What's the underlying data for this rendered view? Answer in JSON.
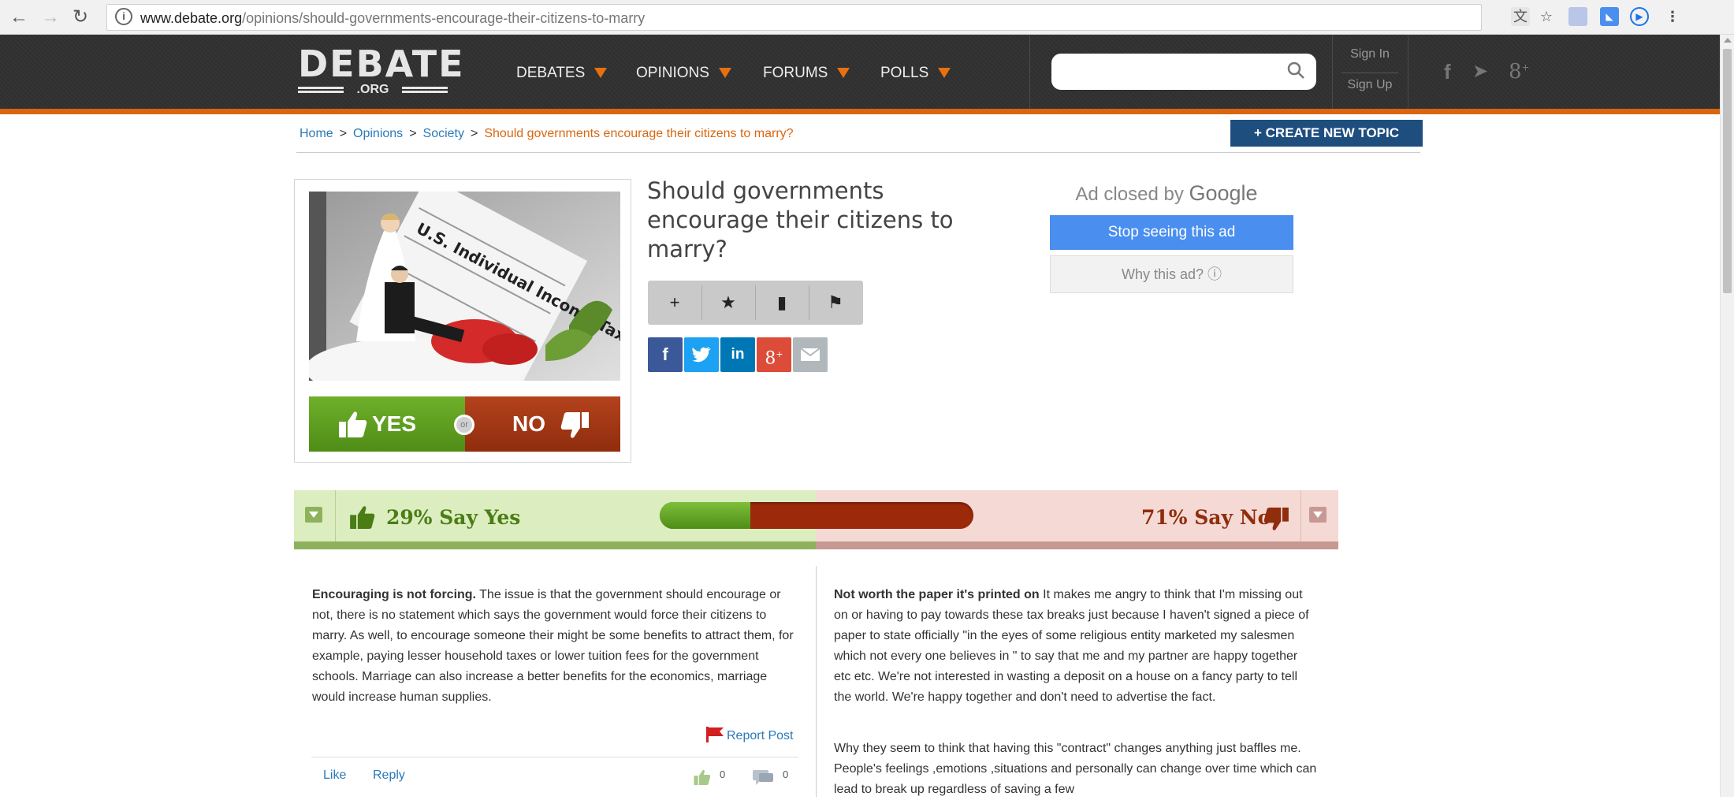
{
  "browser": {
    "url_host": "www.debate.org",
    "url_path": "/opinions/should-governments-encourage-their-citizens-to-marry"
  },
  "site": {
    "logo_main": "DEBATE",
    "logo_sub": ".ORG",
    "menu": [
      {
        "label": "DEBATES"
      },
      {
        "label": "OPINIONS"
      },
      {
        "label": "FORUMS"
      },
      {
        "label": "POLLS"
      }
    ],
    "sign_in": "Sign In",
    "sign_up": "Sign Up",
    "search_placeholder": "",
    "colors": {
      "accent": "#d9660f",
      "header": "#2f2f2f",
      "link": "#2a7ab9"
    }
  },
  "breadcrumb": {
    "home": "Home",
    "opinions": "Opinions",
    "society": "Society",
    "current": "Should governments encourage their citizens to marry?",
    "separator": ">"
  },
  "create_topic": "+ CREATE NEW TOPIC",
  "topic": {
    "title": "Should governments encourage their citizens to marry?",
    "vote_yes": "YES",
    "vote_or": "or",
    "vote_no": "NO",
    "image_caption": "U.S. Individual Income Tax"
  },
  "actions": [
    "plus-icon",
    "star-icon",
    "trash-icon",
    "flag-icon"
  ],
  "share": [
    {
      "icon": "facebook-icon",
      "label": "f",
      "color": "#3b5998"
    },
    {
      "icon": "twitter-icon",
      "label": "t",
      "color": "#1da1f2"
    },
    {
      "icon": "linkedin-icon",
      "label": "in",
      "color": "#0077b5"
    },
    {
      "icon": "googleplus-icon",
      "label": "g+",
      "color": "#dd4b39"
    },
    {
      "icon": "email-icon",
      "label": "",
      "color": "#b0b8bc"
    }
  ],
  "ad": {
    "closed_by": "Ad closed by",
    "brand": "Google",
    "stop": "Stop seeing this ad",
    "why": "Why this ad? ⓘ"
  },
  "results": {
    "yes_label": "29% Say Yes",
    "no_label": "71% Say No",
    "yes_fraction": 0.29
  },
  "arguments": {
    "yes": {
      "title": "Encouraging is not forcing.",
      "body": " The issue is that the government should encourage or not, there is no statement which says the government would force their citizens to marry. As well, to encourage someone their might be some benefits to attract them, for example, paying lesser household taxes or lower tuition fees for the government schools. Marriage can also increase a better benefits for the economics, marriage would increase human supplies.",
      "report": "Report Post",
      "like": "Like",
      "reply": "Reply",
      "up_count": "0",
      "down_count": "0"
    },
    "no": {
      "title": "Not worth the paper it's printed on",
      "body": "  It makes me angry to think that I'm missing out on or having to pay towards these tax breaks just because I haven't signed a piece of paper to state officially \"in the eyes of some religious entity marketed my salesmen which not every one believes in \" to say that me and my partner are happy together etc etc. We're not interested in wasting a deposit on a house on a fancy party to tell the world. We're happy together and don't need to advertise the fact.",
      "body2": "Why they seem to think that having this \"contract\" changes anything just baffles me. People's feelings ,emotions ,situations and personally can change over time which can lead to break up regardless of saving a few"
    }
  }
}
